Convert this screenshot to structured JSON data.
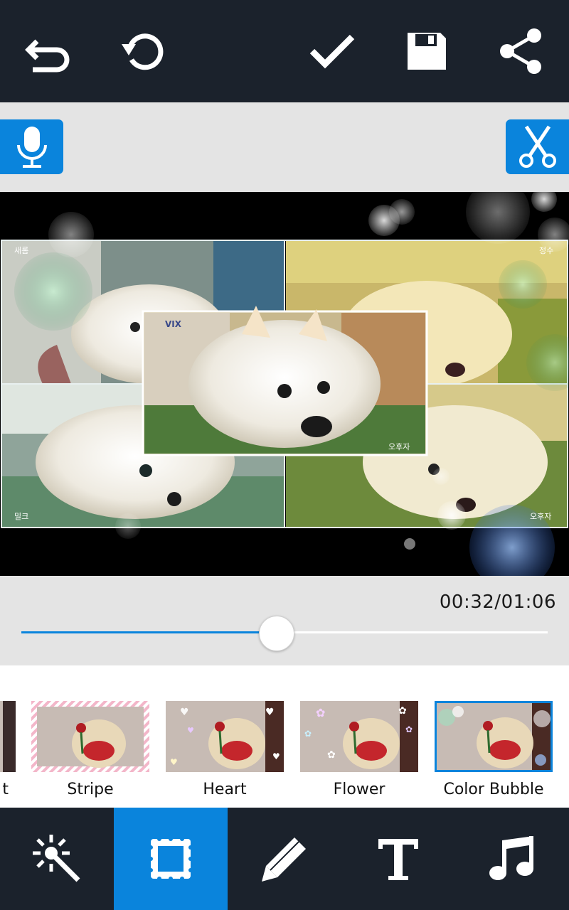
{
  "top_bar": {
    "icons": [
      "undo-icon",
      "reset-icon",
      "check-icon",
      "save-icon",
      "share-icon"
    ]
  },
  "toolbar": {
    "icons": [
      "microphone-icon",
      "scissors-icon"
    ]
  },
  "preview": {
    "tiles": [
      {
        "label": "새롬"
      },
      {
        "label": "정수"
      },
      {
        "label": "오후자"
      },
      {
        "label": "밀크"
      },
      {
        "label": "오후자"
      }
    ],
    "center_label": "오후자",
    "watermark": "VIX"
  },
  "timeline": {
    "time_text": "00:32/01:06",
    "progress": 0.4848
  },
  "frames": {
    "items": [
      {
        "label": "t"
      },
      {
        "label": "Stripe"
      },
      {
        "label": "Heart"
      },
      {
        "label": "Flower"
      },
      {
        "label": "Color Bubble"
      }
    ],
    "selected_index": 4
  },
  "bottom_bar": {
    "icons": [
      "magic-wand-icon",
      "frame-icon",
      "pencil-icon",
      "text-icon",
      "music-note-icon"
    ],
    "active_index": 1
  },
  "colors": {
    "accent": "#0a84dc",
    "bar_background": "#1b222c",
    "panel_background": "#e4e4e4"
  }
}
